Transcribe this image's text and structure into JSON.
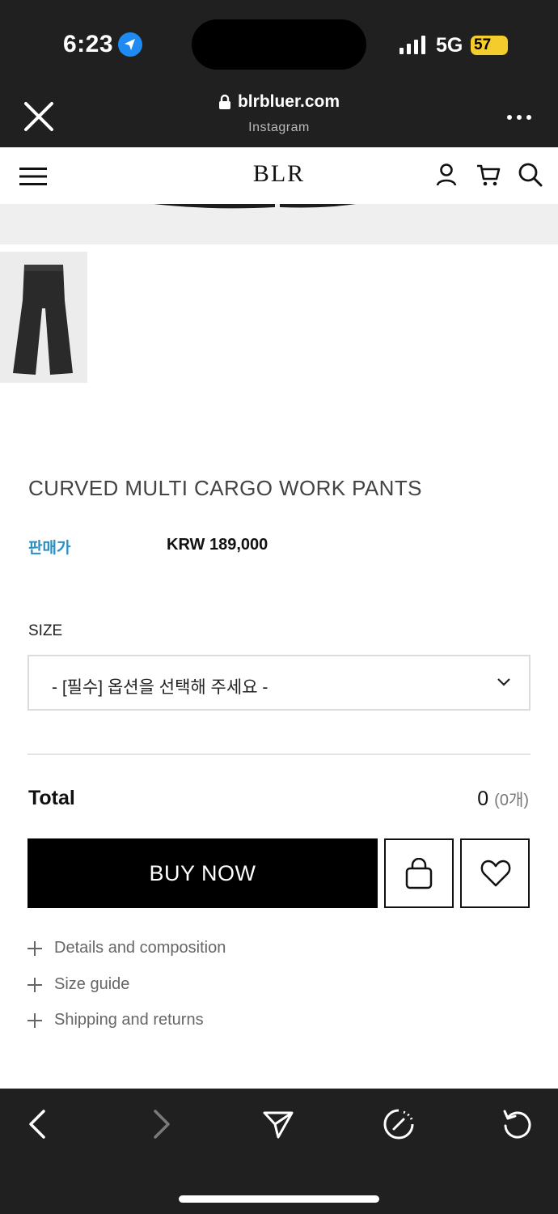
{
  "status_bar": {
    "time": "6:23",
    "network": "5G",
    "battery": "57"
  },
  "browser": {
    "url": "blrbluer.com",
    "source": "Instagram"
  },
  "site": {
    "logo": "BLR"
  },
  "product": {
    "title": "CURVED MULTI CARGO WORK PANTS",
    "price_label": "판매가",
    "price": "KRW 189,000"
  },
  "options": {
    "size_label": "SIZE",
    "size_placeholder": "- [필수] 옵션을 선택해 주세요 -"
  },
  "summary": {
    "total_label": "Total",
    "total_value": "0",
    "total_count": "(0개)"
  },
  "actions": {
    "buy_now": "BUY NOW"
  },
  "accordion": [
    {
      "label": "Details and composition"
    },
    {
      "label": "Size guide"
    },
    {
      "label": "Shipping and returns"
    }
  ],
  "colors": {
    "price_label": "#2b8fc4",
    "chrome_bg": "#202020",
    "buy_button": "#000000",
    "battery": "#f4cc2b"
  }
}
